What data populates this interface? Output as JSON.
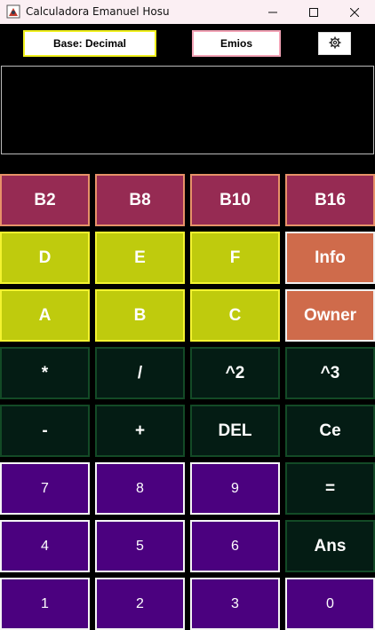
{
  "window": {
    "title": "Calculadora Emanuel Hosu"
  },
  "toolbar": {
    "base_label": "Base: Decimal",
    "emios_label": "Emios",
    "settings_icon": "gear-icon"
  },
  "display": {
    "value": ""
  },
  "keys": {
    "b2": "B2",
    "b8": "B8",
    "b10": "B10",
    "b16": "B16",
    "d": "D",
    "e": "E",
    "f": "F",
    "info": "Info",
    "a": "A",
    "b": "B",
    "c": "C",
    "owner": "Owner",
    "mul": "*",
    "div": "/",
    "sq": "^2",
    "cube": "^3",
    "minus": "-",
    "plus": "+",
    "del": "DEL",
    "ce": "Ce",
    "n7": "7",
    "n8": "8",
    "n9": "9",
    "eq": "=",
    "n4": "4",
    "n5": "5",
    "n6": "6",
    "ans": "Ans",
    "n1": "1",
    "n2": "2",
    "n3": "3",
    "n0": "0"
  },
  "colors": {
    "base_keys": "#962b53",
    "hex_keys": "#bfcb0d",
    "info_keys": "#cf6b4b",
    "operator_keys": "#041c14",
    "number_keys": "#4b017f",
    "title_bar": "#fbeff3"
  }
}
